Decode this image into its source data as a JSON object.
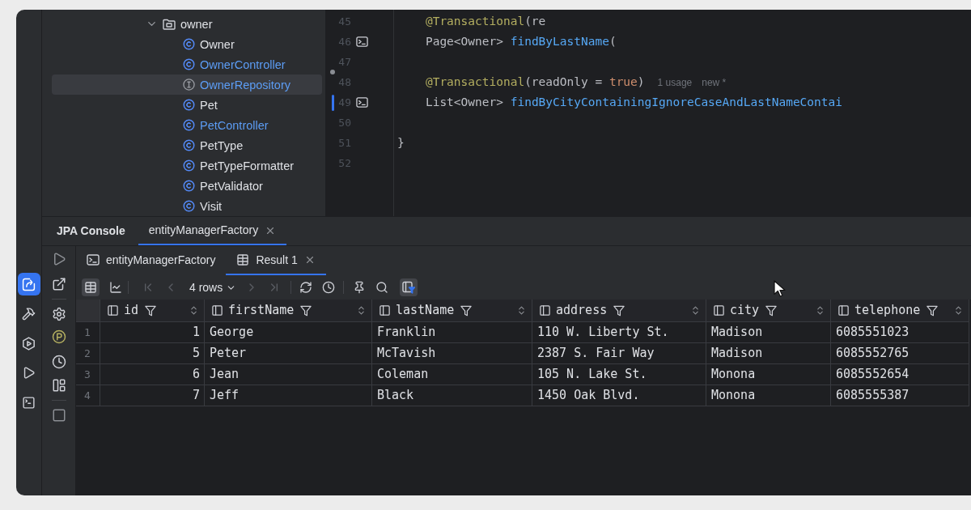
{
  "tool_window_stripe": [
    {
      "kind": "services",
      "selected": true
    },
    {
      "kind": "build",
      "selected": false
    },
    {
      "kind": "deploy",
      "selected": false
    },
    {
      "kind": "run",
      "selected": false
    },
    {
      "kind": "terminal",
      "selected": false
    }
  ],
  "project_tree": [
    {
      "label": "owner",
      "kind": "folder",
      "expanded": true,
      "selected": false,
      "modified": false,
      "children": [
        {
          "label": "Owner",
          "kind": "class",
          "selected": false,
          "modified": false
        },
        {
          "label": "OwnerController",
          "kind": "class",
          "selected": false,
          "modified": true
        },
        {
          "label": "OwnerRepository",
          "kind": "interface",
          "selected": true,
          "modified": true
        },
        {
          "label": "Pet",
          "kind": "class",
          "selected": false,
          "modified": false
        },
        {
          "label": "PetController",
          "kind": "class",
          "selected": false,
          "modified": true
        },
        {
          "label": "PetType",
          "kind": "class",
          "selected": false,
          "modified": false
        },
        {
          "label": "PetTypeFormatter",
          "kind": "class",
          "selected": false,
          "modified": false
        },
        {
          "label": "PetValidator",
          "kind": "class",
          "selected": false,
          "modified": false
        },
        {
          "label": "Visit",
          "kind": "class",
          "selected": false,
          "modified": false
        }
      ]
    }
  ],
  "editor": {
    "lines": [
      {
        "number": "45",
        "changed": false,
        "deleted": false,
        "run_marker": false,
        "tokens": [
          {
            "kind": "annotation",
            "text": "    @Transactional"
          },
          {
            "kind": "plain",
            "text": "(re"
          }
        ]
      },
      {
        "number": "46",
        "changed": false,
        "deleted": false,
        "run_marker": true,
        "tokens": [
          {
            "kind": "plain",
            "text": "    Page<Owner> "
          },
          {
            "kind": "method",
            "text": "findByLastName"
          },
          {
            "kind": "plain",
            "text": "("
          }
        ]
      },
      {
        "number": "47",
        "changed": false,
        "deleted": false,
        "run_marker": false
      },
      {
        "number": "48",
        "changed": false,
        "deleted": true,
        "run_marker": false,
        "tokens": [
          {
            "kind": "annotation",
            "text": "    @Transactional"
          },
          {
            "kind": "plain",
            "text": "(readOnly = "
          },
          {
            "kind": "keyword",
            "text": "true"
          },
          {
            "kind": "plain",
            "text": ")"
          }
        ],
        "hints": [
          "1 usage",
          "new *"
        ]
      },
      {
        "number": "49",
        "changed": true,
        "deleted": false,
        "run_marker": true,
        "tokens": [
          {
            "kind": "plain",
            "text": "    List<Owner> "
          },
          {
            "kind": "method",
            "text": "findByCityContainingIgnoreCaseAndLastNameContai"
          }
        ]
      },
      {
        "number": "50",
        "changed": false,
        "deleted": false,
        "run_marker": false
      },
      {
        "number": "51",
        "changed": false,
        "deleted": false,
        "run_marker": false,
        "tokens": [
          {
            "kind": "plain",
            "text": "}"
          }
        ]
      },
      {
        "number": "52",
        "changed": false,
        "deleted": false,
        "run_marker": false
      }
    ]
  },
  "jpa_console": {
    "title": "JPA Console",
    "tabs": [
      {
        "label": "entityManagerFactory",
        "selected": true,
        "closable": true
      }
    ],
    "session_tabs": [
      {
        "label": "entityManagerFactory",
        "kind": "console",
        "selected": false,
        "closable": false
      },
      {
        "label": "Result 1",
        "kind": "result",
        "selected": true,
        "closable": true
      }
    ],
    "result_toolbar": {
      "view_modes": [
        {
          "kind": "table",
          "selected": true
        },
        {
          "kind": "chart",
          "selected": false
        }
      ],
      "paging": [
        {
          "kind": "first",
          "disabled": true
        },
        {
          "kind": "previous",
          "disabled": true
        },
        {
          "kind": "page_size",
          "label": "4 rows",
          "disabled": false
        },
        {
          "kind": "next",
          "disabled": true
        },
        {
          "kind": "last",
          "disabled": true
        }
      ],
      "actions": [
        {
          "kind": "refresh",
          "on": false
        },
        {
          "kind": "history",
          "on": false
        },
        {
          "kind": "pin",
          "on": false
        },
        {
          "kind": "search",
          "on": false
        },
        {
          "kind": "column_filter",
          "on": true
        }
      ]
    },
    "table": {
      "columns": [
        {
          "name": "id",
          "kind": "number"
        },
        {
          "name": "firstName",
          "kind": "text"
        },
        {
          "name": "lastName",
          "kind": "text"
        },
        {
          "name": "address",
          "kind": "text"
        },
        {
          "name": "city",
          "kind": "text"
        },
        {
          "name": "telephone",
          "kind": "text"
        }
      ],
      "rows": [
        {
          "number": "1",
          "cells": [
            "1",
            "George",
            "Franklin",
            "110 W. Liberty St.",
            "Madison",
            "6085551023"
          ]
        },
        {
          "number": "2",
          "cells": [
            "5",
            "Peter",
            "McTavish",
            "2387 S. Fair Way",
            "Madison",
            "6085552765"
          ]
        },
        {
          "number": "3",
          "cells": [
            "6",
            "Jean",
            "Coleman",
            "105 N. Lake St.",
            "Monona",
            "6085552654"
          ]
        },
        {
          "number": "4",
          "cells": [
            "7",
            "Jeff",
            "Black",
            "1450 Oak Blvd.",
            "Monona",
            "6085555387"
          ]
        }
      ]
    }
  }
}
